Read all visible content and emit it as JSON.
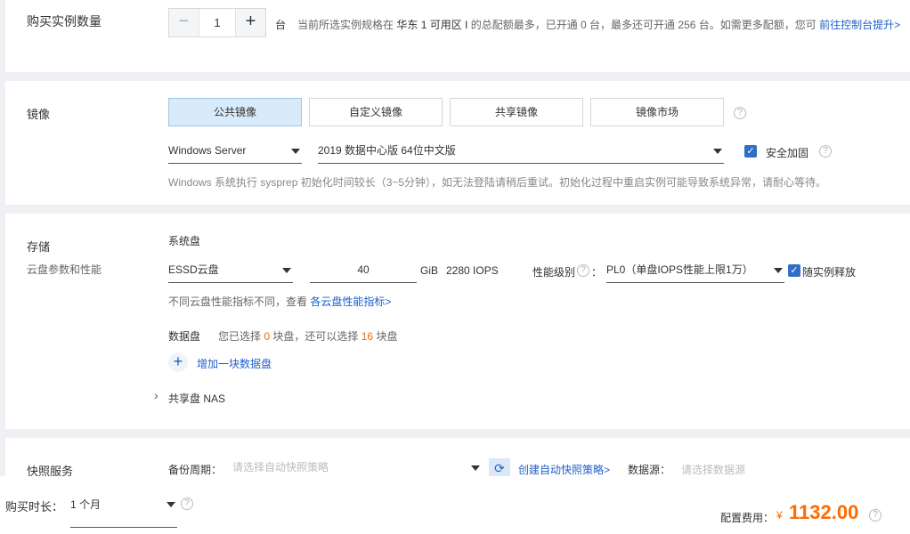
{
  "quantity": {
    "label": "购买实例数量",
    "minus": "−",
    "value": "1",
    "plus": "+",
    "unit": "台",
    "hint_prefix": "当前所选实例规格在",
    "region": "华东 1 可用区 I",
    "hint_mid": "的总配额最多，已开通 0 台，最多还可开通 256 台。如需更多配额，您可",
    "hint_link": "前往控制台提升>"
  },
  "image": {
    "label": "镜像",
    "tabs": [
      {
        "label": "公共镜像",
        "active": true
      },
      {
        "label": "自定义镜像",
        "active": false
      },
      {
        "label": "共享镜像",
        "active": false
      },
      {
        "label": "镜像市场",
        "active": false
      }
    ],
    "os_select": "Windows Server",
    "version_select": "2019 数据中心版 64位中文版",
    "security_label": "安全加固",
    "notice": "Windows 系统执行 sysprep 初始化时间较长（3~5分钟），如无法登陆请稍后重试。初始化过程中重启实例可能导致系统异常，请耐心等待。"
  },
  "storage": {
    "label": "存储",
    "sublabel": "云盘参数和性能",
    "system_disk_label": "系统盘",
    "disk_type": "ESSD云盘",
    "disk_size": "40",
    "disk_unit": "GiB",
    "iops": "2280 IOPS",
    "perf_label": "性能级别",
    "perf_colon": "：",
    "perf_select": "PL0（单盘IOPS性能上限1万）",
    "release_label": "随实例释放",
    "disk_hint": "不同云盘性能指标不同，查看",
    "disk_hint_link": "各云盘性能指标>",
    "data_disk_label": "数据盘",
    "data_hint_1": "您已选择",
    "data_selected": "0",
    "data_hint_2": "块盘，还可以选择",
    "data_remaining": "16",
    "data_hint_3": "块盘",
    "add_disk": "增加一块数据盘",
    "nas_label": "共享盘 NAS",
    "chevron": "›"
  },
  "snapshot": {
    "label": "快照服务",
    "backup_label": "备份周期：",
    "backup_placeholder": "请选择自动快照策略",
    "create_link": "创建自动快照策略>",
    "source_label": "数据源：",
    "source_placeholder": "请选择数据源"
  },
  "footer": {
    "duration_label": "购买时长：",
    "duration_value": "1 个月",
    "cost_label": "配置费用：",
    "currency": "¥",
    "price": "1132.00"
  },
  "icons": {
    "help": "?",
    "check": "✓",
    "plus": "+",
    "refresh": "⟳"
  },
  "colors": {
    "accent": "#1e5fcc",
    "price": "#ff6a00",
    "active_tab": "#d8ebfa"
  }
}
